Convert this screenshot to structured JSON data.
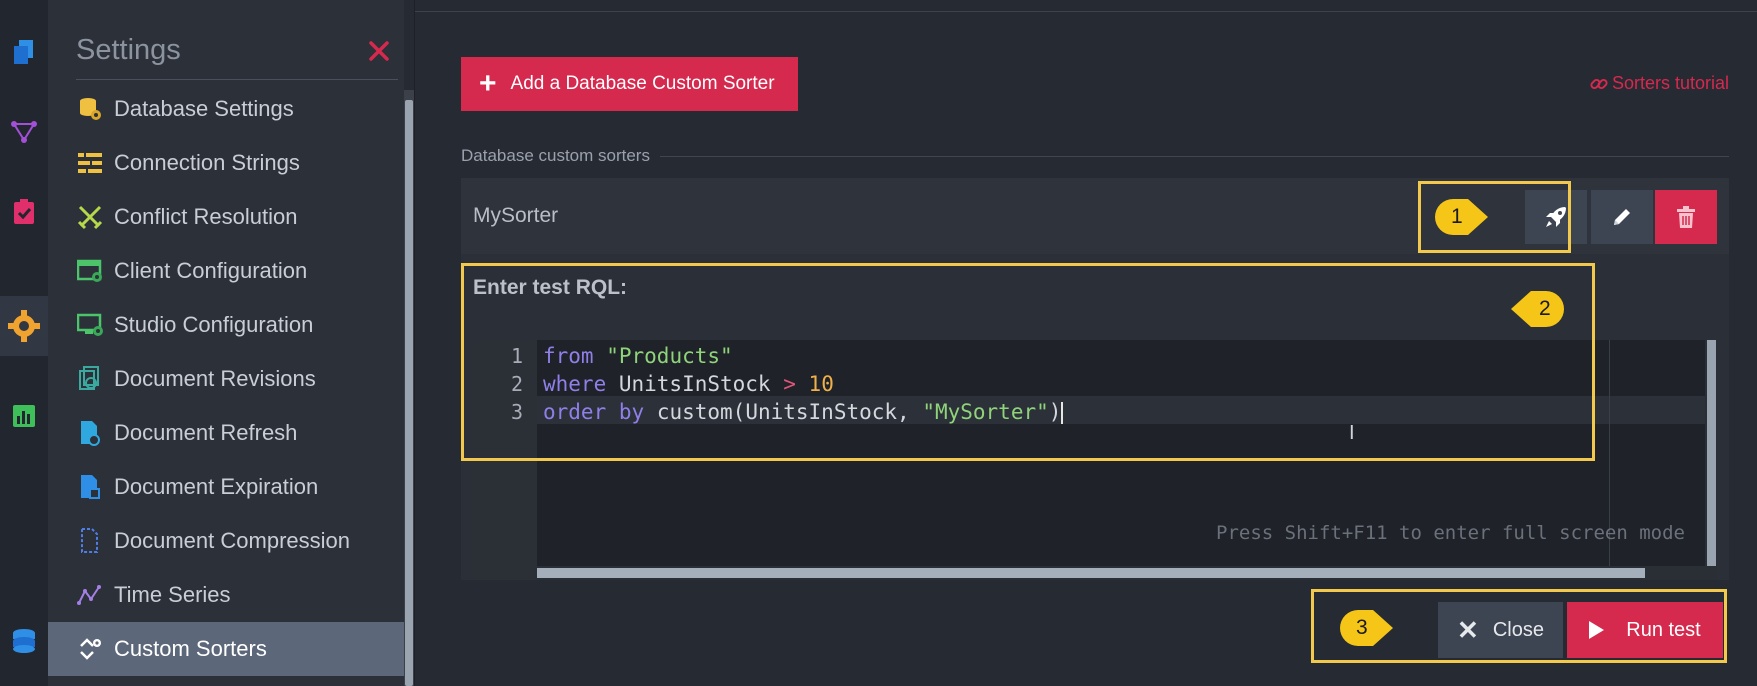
{
  "settings": {
    "title": "Settings",
    "menu": [
      {
        "label": "Database Settings",
        "icon": "database-gear-icon"
      },
      {
        "label": "Connection Strings",
        "icon": "connection-strings-icon"
      },
      {
        "label": "Conflict Resolution",
        "icon": "crossed-swords-icon"
      },
      {
        "label": "Client Configuration",
        "icon": "client-config-icon"
      },
      {
        "label": "Studio Configuration",
        "icon": "studio-config-icon"
      },
      {
        "label": "Document Revisions",
        "icon": "revisions-icon"
      },
      {
        "label": "Document Refresh",
        "icon": "document-refresh-icon"
      },
      {
        "label": "Document Expiration",
        "icon": "document-expiration-icon"
      },
      {
        "label": "Document Compression",
        "icon": "document-compression-icon"
      },
      {
        "label": "Time Series",
        "icon": "time-series-icon"
      },
      {
        "label": "Custom Sorters",
        "icon": "custom-sorters-icon",
        "active": true
      }
    ]
  },
  "toolbar": {
    "add_label": "Add a Database Custom Sorter",
    "tutorial_label": "Sorters tutorial"
  },
  "section_label": "Database custom sorters",
  "sorter": {
    "name": "MySorter"
  },
  "rql": {
    "label": "Enter test RQL:",
    "line_numbers": [
      "1",
      "2",
      "3"
    ],
    "lines": [
      [
        {
          "t": "from",
          "c": "kw"
        },
        {
          "t": " ",
          "c": ""
        },
        {
          "t": "\"Products\"",
          "c": "str"
        }
      ],
      [
        {
          "t": "where",
          "c": "kw"
        },
        {
          "t": " UnitsInStock ",
          "c": ""
        },
        {
          "t": ">",
          "c": "op"
        },
        {
          "t": " ",
          "c": ""
        },
        {
          "t": "10",
          "c": "num"
        }
      ],
      [
        {
          "t": "order",
          "c": "kw"
        },
        {
          "t": " ",
          "c": ""
        },
        {
          "t": "by",
          "c": "kw"
        },
        {
          "t": " custom(UnitsInStock, ",
          "c": ""
        },
        {
          "t": "\"MySorter\"",
          "c": "str"
        },
        {
          "t": ")",
          "c": ""
        }
      ]
    ],
    "fullscreen_hint": "Press Shift+F11 to enter full screen mode"
  },
  "footer": {
    "close_label": "Close",
    "run_label": "Run test"
  },
  "annotations": {
    "callout_1": "1",
    "callout_2": "2",
    "callout_3": "3"
  },
  "colors": {
    "accent": "#d6294e",
    "highlight": "#f2c94c",
    "panel": "#2b3039"
  }
}
